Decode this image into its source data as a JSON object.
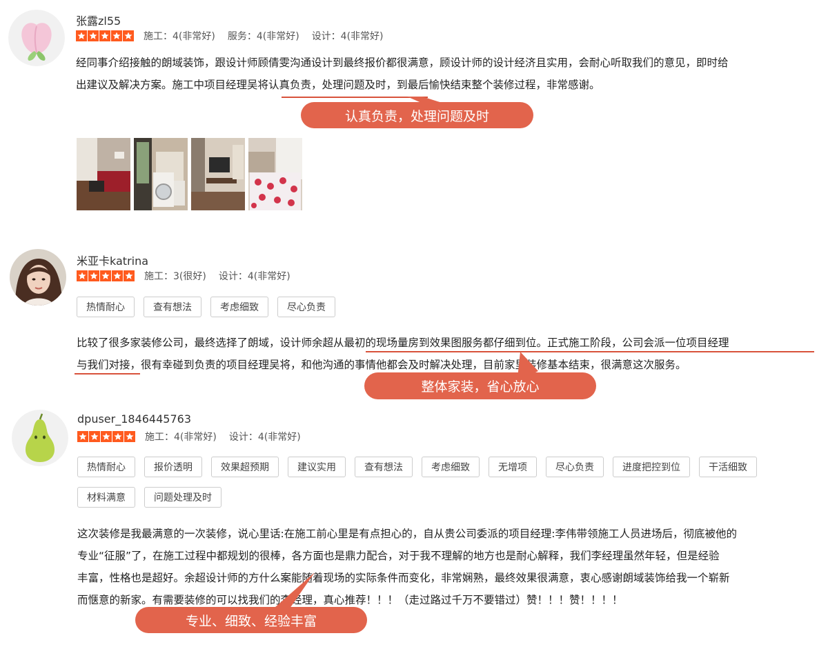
{
  "reviews": [
    {
      "username": "张露zl55",
      "scores": [
        "施工：4(非常好)",
        "服务：4(非常好)",
        "设计：4(非常好)"
      ],
      "text_lines": [
        "经同事介绍接触的朗域装饰，跟设计师顾倩雯沟通设计到最终报价都很满意，顾设计师的设计经济且实用，会耐心听取我们的意见，即时给",
        "出建议及解决方案。施工中项目经理吴将认真负责，处理问题及时，到最后愉快结束整个装修过程，非常感谢。"
      ],
      "callout": "认真负责，处理问题及时",
      "photos": [
        "living-room-photo",
        "balcony-washer-photo",
        "tv-wall-photo",
        "bedroom-photo"
      ]
    },
    {
      "username": "米亚卡katrina",
      "scores": [
        "施工：3(很好)",
        "设计：4(非常好)"
      ],
      "tags": [
        "热情耐心",
        "查有想法",
        "考虑细致",
        "尽心负责"
      ],
      "text_lines": [
        "比较了很多家装修公司，最终选择了朗域，设计师余超从最初的现场量房到效果图服务都仔细到位。正式施工阶段，公司会派一位项目经理",
        "与我们对接，很有幸碰到负责的项目经理吴将，和他沟通的事情他都会及时解决处理，目前家里装修基本结束，很满意这次服务。"
      ],
      "callout": "整体家装，省心放心"
    },
    {
      "username": "dpuser_1846445763",
      "scores": [
        "施工：4(非常好)",
        "设计：4(非常好)"
      ],
      "tags": [
        "热情耐心",
        "报价透明",
        "效果超预期",
        "建议实用",
        "查有想法",
        "考虑细致",
        "无增项",
        "尽心负责",
        "进度把控到位",
        "干活细致",
        "材料满意",
        "问题处理及时"
      ],
      "text_lines": [
        "这次装修是我最满意的一次装修，说心里话:在施工前心里是有点担心的，自从贵公司委派的项目经理:李伟带领施工人员进场后，彻底被他的",
        "专业“征服”了，在施工过程中都规划的很棒，各方面也是鼎力配合，对于我不理解的地方也是耐心解释，我们李经理虽然年轻，但是经验",
        "丰富，性格也是超好。余超设计师的方什么案能随着现场的实际条件而变化，非常娴熟，最终效果很满意，衷心感谢朗域装饰给我一个崭新",
        "而惬意的新家。有需要装修的可以找我们的李经理，真心推荐！！！（走过路过千万不要错过）赞！！！赞！！！！"
      ],
      "callout": "专业、细致、经验丰富"
    }
  ],
  "colors": {
    "star": "#ff5a1e",
    "callout": "#e2644c",
    "underline": "#d8513a"
  }
}
